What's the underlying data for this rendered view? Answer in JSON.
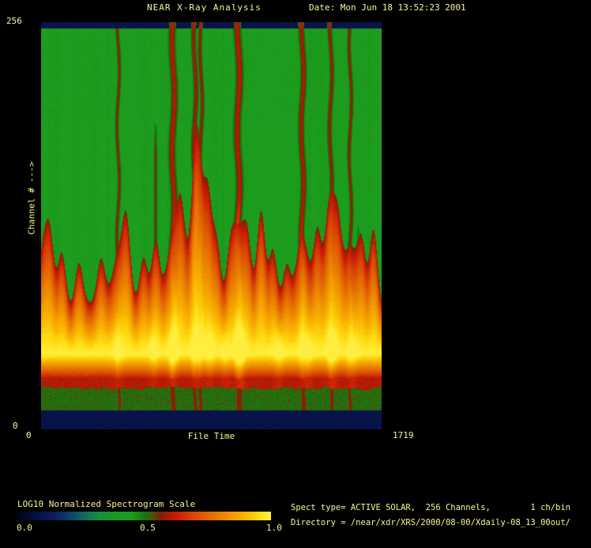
{
  "header": {
    "title": "NEAR X-Ray Analysis",
    "date": "Date: Mon Jun 18 13:52:23 2001"
  },
  "plot": {
    "y_axis": {
      "max": "256",
      "min": "0",
      "title": "Channel # --->"
    },
    "x_axis": {
      "min": "0",
      "max": "1719",
      "title": "File Time"
    }
  },
  "colorbar": {
    "title": "LOG10 Normalized Spectrogram Scale",
    "tick_labels": [
      "0.0",
      "0.5",
      "1.0"
    ]
  },
  "info": {
    "line1": "Spect type= ACTIVE SOLAR,  256 Channels,        1 ch/bin",
    "line2": "Directory = /near/xdr/XRS/2000/08-00/Xdaily-08_13_00out/"
  },
  "colors": {
    "background": "#000000",
    "text_yellow": "#f7f596",
    "navy_band": "#0c2157",
    "background_green": "#1d9e1e",
    "streak_red": "#c01808",
    "bright_yellow": "#ffd830"
  },
  "chart_data": {
    "type": "heatmap",
    "title": "NEAR X-Ray Analysis",
    "xlabel": "File Time",
    "ylabel": "Channel # --->",
    "xlim": [
      0,
      1719
    ],
    "ylim": [
      0,
      256
    ],
    "colorbar": {
      "label": "LOG10 Normalized Spectrogram Scale",
      "ticks": [
        0.0,
        0.5,
        1.0
      ],
      "colormap_stops": [
        [
          0.0,
          2,
          4,
          20
        ],
        [
          0.07,
          6,
          16,
          64
        ],
        [
          0.14,
          11,
          28,
          92
        ],
        [
          0.2,
          14,
          60,
          104
        ],
        [
          0.26,
          18,
          106,
          90
        ],
        [
          0.32,
          22,
          142,
          64
        ],
        [
          0.38,
          26,
          152,
          38
        ],
        [
          0.45,
          30,
          158,
          28
        ],
        [
          0.5,
          22,
          120,
          14
        ],
        [
          0.535,
          70,
          84,
          8
        ],
        [
          0.565,
          130,
          32,
          6
        ],
        [
          0.62,
          198,
          26,
          5
        ],
        [
          0.7,
          218,
          74,
          4
        ],
        [
          0.8,
          234,
          126,
          2
        ],
        [
          0.9,
          250,
          182,
          0
        ],
        [
          0.965,
          255,
          226,
          24
        ],
        [
          1.0,
          255,
          238,
          64
        ]
      ]
    },
    "bands": {
      "top_blank_channels": [
        252,
        256
      ],
      "bottom_blank_channels": [
        0,
        12
      ],
      "low_channel_noise_band": [
        12,
        26
      ],
      "red_edge_channels": [
        26,
        32
      ],
      "bright_band_peak_channel": 48,
      "flame_top_channel_range": [
        78,
        107
      ],
      "background_level": 0.44,
      "bright_band_level": 1.0
    },
    "flare_streaks": [
      {
        "t": 387,
        "intensity": 0.5,
        "core": 0.3,
        "width": 1.6
      },
      {
        "t": 665,
        "intensity": 0.8,
        "core": 0.85,
        "width": 3.0
      },
      {
        "t": 774,
        "intensity": 0.65,
        "core": 0.55,
        "width": 2.2
      },
      {
        "t": 806,
        "intensity": 0.6,
        "core": 0.45,
        "width": 1.8
      },
      {
        "t": 994,
        "intensity": 0.85,
        "core": 1.0,
        "width": 3.2
      },
      {
        "t": 1317,
        "intensity": 0.75,
        "core": 0.75,
        "width": 2.6
      },
      {
        "t": 1460,
        "intensity": 0.6,
        "core": 0.5,
        "width": 2.0
      },
      {
        "t": 1559,
        "intensity": 0.55,
        "core": 0.35,
        "width": 1.7
      }
    ],
    "faint_streaks": [
      {
        "t": 576,
        "top_frac": 0.25,
        "w": 1.5
      },
      {
        "t": 705,
        "top_frac": 0.45,
        "w": 1.4
      },
      {
        "t": 877,
        "top_frac": 0.55,
        "w": 1.3
      },
      {
        "t": 1599,
        "top_frac": 0.5,
        "w": 1.3
      }
    ],
    "flame_peaks": [
      {
        "t": 9,
        "h": 14
      },
      {
        "t": 43,
        "h": 20
      },
      {
        "t": 103,
        "h": 16
      },
      {
        "t": 189,
        "h": 14
      },
      {
        "t": 301,
        "h": 12
      },
      {
        "t": 430,
        "h": 20
      },
      {
        "t": 516,
        "h": 14
      },
      {
        "t": 576,
        "h": 18
      },
      {
        "t": 705,
        "h": 20
      },
      {
        "t": 782,
        "h": 24
      },
      {
        "t": 842,
        "h": 22
      },
      {
        "t": 885,
        "h": 18
      },
      {
        "t": 954,
        "h": 12
      },
      {
        "t": 1040,
        "h": 14
      },
      {
        "t": 1109,
        "h": 26
      },
      {
        "t": 1169,
        "h": 16
      },
      {
        "t": 1238,
        "h": 12
      },
      {
        "t": 1392,
        "h": 20
      },
      {
        "t": 1453,
        "h": 14
      },
      {
        "t": 1496,
        "h": 18
      },
      {
        "t": 1616,
        "h": 18
      },
      {
        "t": 1676,
        "h": 22
      }
    ],
    "bottom_bright_columns": [
      {
        "t": 387,
        "s": 0.5
      },
      {
        "t": 567,
        "s": 0.55
      },
      {
        "t": 665,
        "s": 0.75
      },
      {
        "t": 786,
        "s": 0.6
      },
      {
        "t": 849,
        "s": 0.55
      },
      {
        "t": 928,
        "s": 0.5
      },
      {
        "t": 1006,
        "s": 1.0
      },
      {
        "t": 1197,
        "s": 0.55
      },
      {
        "t": 1344,
        "s": 0.6
      },
      {
        "t": 1468,
        "s": 0.8
      },
      {
        "t": 1568,
        "s": 0.5
      }
    ]
  }
}
